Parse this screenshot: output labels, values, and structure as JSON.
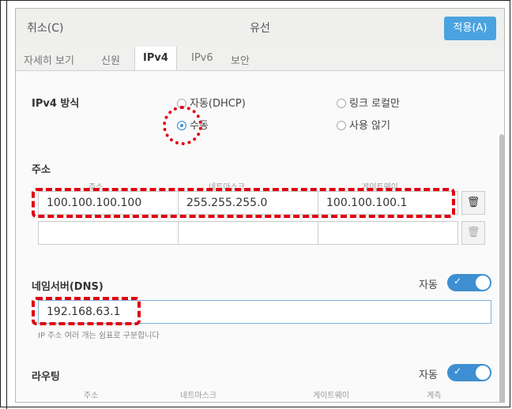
{
  "header": {
    "cancel_label": "취소(C)",
    "title": "유선",
    "apply_label": "적용(A)"
  },
  "tabs": [
    {
      "label": "자세히 보기"
    },
    {
      "label": "신원"
    },
    {
      "label": "IPv4"
    },
    {
      "label": "IPv6"
    },
    {
      "label": "보안"
    }
  ],
  "ipv4": {
    "method_label": "IPv4 방식",
    "options": [
      {
        "label": "자동(DHCP)",
        "selected": false
      },
      {
        "label": "링크 로컬만",
        "selected": false
      },
      {
        "label": "수동",
        "selected": true
      },
      {
        "label": "사용 않기",
        "selected": false
      }
    ]
  },
  "address": {
    "section_label": "주소",
    "columns": [
      "주소",
      "네트마스크",
      "게이트웨이"
    ],
    "rows": [
      {
        "address": "100.100.100.100",
        "netmask": "255.255.255.0",
        "gateway": "100.100.100.1"
      },
      {
        "address": "",
        "netmask": "",
        "gateway": ""
      }
    ]
  },
  "dns": {
    "section_label": "네임서버(DNS)",
    "auto_label": "자동",
    "auto_on": true,
    "value": "192.168.63.1",
    "hint": "IP 주소 여러 개는 쉼표로 구분합니다"
  },
  "routing": {
    "section_label": "라우팅",
    "auto_label": "자동",
    "auto_on": true,
    "columns": [
      "주소",
      "네트마스크",
      "게이트웨이",
      "계측"
    ]
  },
  "icons": {
    "trash": "trash-icon",
    "check": "check-icon"
  },
  "colors": {
    "accent": "#3d8fd1",
    "apply_button": "#4aa3df",
    "highlight": "#e0000f"
  }
}
